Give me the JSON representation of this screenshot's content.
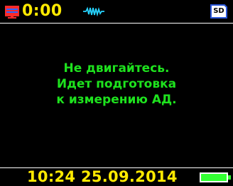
{
  "status_bar": {
    "record_icon": "monitor-icon",
    "timer": "0:00",
    "signal_icon": "pulse-signal-icon",
    "sd_label": "SD",
    "accent_color": "#ffea00"
  },
  "message": {
    "lines": [
      "Не двигайтесь.",
      "Идет подготовка",
      "к измерению АД."
    ],
    "color": "#1ee21e"
  },
  "bottom_bar": {
    "datetime": "10:24 25.09.2014",
    "battery_icon": "battery-full-icon",
    "battery_level": 1.0,
    "battery_color": "#33ff33"
  }
}
